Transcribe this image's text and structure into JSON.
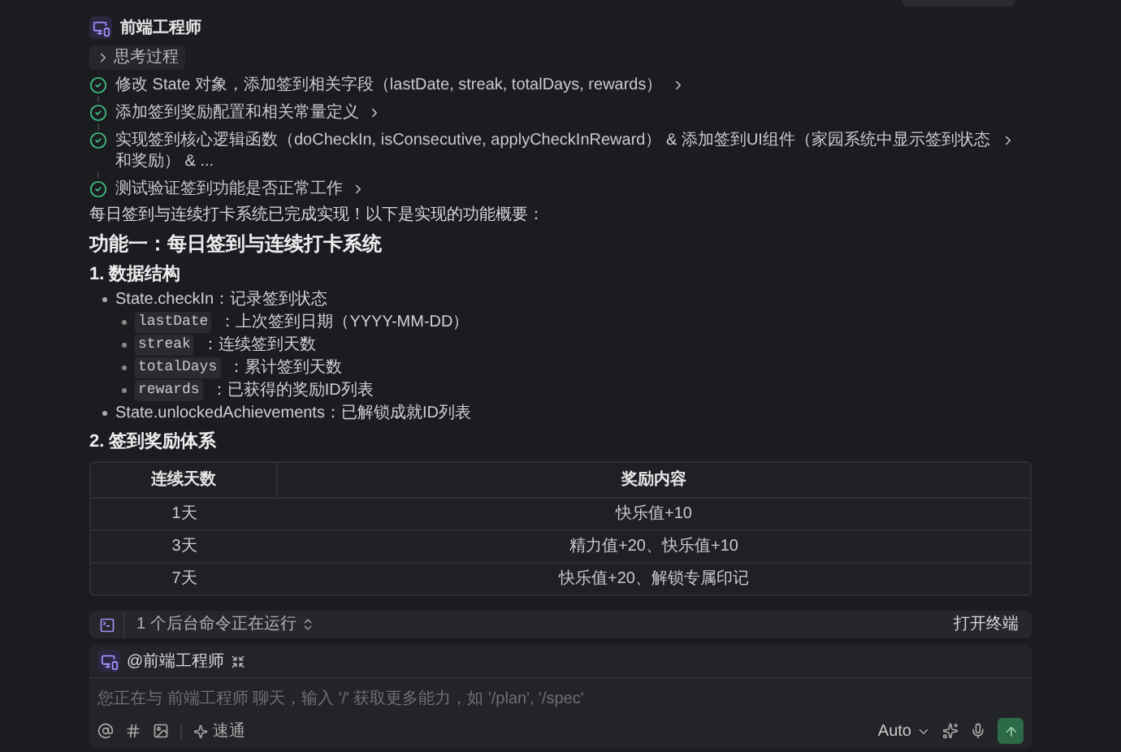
{
  "agent": {
    "name": "前端工程师"
  },
  "thinking": {
    "label": "思考过程",
    "expanded": false
  },
  "steps": [
    {
      "text": "修改 State 对象，添加签到相关字段（lastDate, streak, totalDays, rewards）",
      "done": true
    },
    {
      "text": "添加签到奖励配置和相关常量定义",
      "done": true
    },
    {
      "text": "实现签到核心逻辑函数（doCheckIn, isConsecutive, applyCheckInReward） & 添加签到UI组件（家园系统中显示签到状态和奖励） & ...",
      "done": true
    },
    {
      "text": "测试验证签到功能是否正常工作",
      "done": true
    }
  ],
  "intro": "每日签到与连续打卡系统已完成实现！以下是实现的功能概要：",
  "feature_title": "功能一：每日签到与连续打卡系统",
  "sections": [
    {
      "heading": "1. 数据结构",
      "bullets": [
        {
          "text": "State.checkIn：记录签到状态",
          "children": [
            {
              "code": "lastDate",
              "text": "：上次签到日期（YYYY-MM-DD）"
            },
            {
              "code": "streak",
              "text": "：连续签到天数"
            },
            {
              "code": "totalDays",
              "text": "：累计签到天数"
            },
            {
              "code": "rewards",
              "text": "：已获得的奖励ID列表"
            }
          ]
        },
        {
          "text": "State.unlockedAchievements：已解锁成就ID列表"
        }
      ]
    },
    {
      "heading": "2. 签到奖励体系",
      "table": {
        "columns": [
          "连续天数",
          "奖励内容"
        ],
        "rows": [
          [
            "1天",
            "快乐值+10"
          ],
          [
            "3天",
            "精力值+20、快乐值+10"
          ],
          [
            "7天",
            "快乐值+20、解锁专属印记"
          ]
        ]
      }
    }
  ],
  "status_bar": {
    "text": "1 个后台命令正在运行",
    "action": "打开终端"
  },
  "composer": {
    "mention": "@前端工程师",
    "placeholder": "您正在与 前端工程师 聊天，输入 '/' 获取更多能力，如 '/plan', '/spec'",
    "mode": "速通",
    "model": "Auto"
  }
}
